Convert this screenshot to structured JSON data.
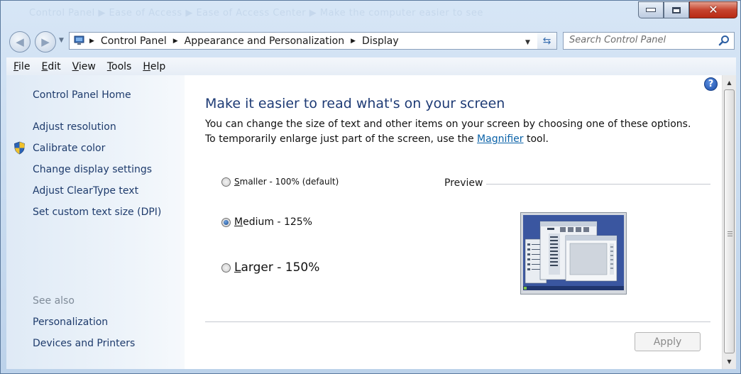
{
  "window": {
    "ghost_title": "Control Panel  ▶  Ease of Access  ▶  Ease of Access Center  ▶  Make the computer easier to see",
    "close_glyph": "✕"
  },
  "nav": {
    "back_glyph": "◀",
    "forward_glyph": "▶",
    "breadcrumb": [
      "Control Panel",
      "Appearance and Personalization",
      "Display"
    ],
    "breadcrumb_separator": "▶",
    "dropdown_glyph": "▼",
    "refresh_glyph": "⇆",
    "search_placeholder": "Search Control Panel"
  },
  "menu": [
    {
      "accel": "F",
      "rest": "ile"
    },
    {
      "accel": "E",
      "rest": "dit"
    },
    {
      "accel": "V",
      "rest": "iew"
    },
    {
      "accel": "T",
      "rest": "ools"
    },
    {
      "accel": "H",
      "rest": "elp"
    }
  ],
  "sidebar": {
    "home": "Control Panel Home",
    "links": [
      "Adjust resolution",
      "Calibrate color",
      "Change display settings",
      "Adjust ClearType text",
      "Set custom text size (DPI)"
    ],
    "see_also_heading": "See also",
    "see_also": [
      "Personalization",
      "Devices and Printers"
    ]
  },
  "main": {
    "help_glyph": "?",
    "heading": "Make it easier to read what's on your screen",
    "description_before": "You can change the size of text and other items on your screen by choosing one of these options. To temporarily enlarge just part of the screen, use the ",
    "description_link": "Magnifier",
    "description_after": " tool.",
    "options": [
      {
        "accel": "S",
        "rest": "maller - 100% (default)",
        "checked": false
      },
      {
        "accel": "M",
        "rest": "edium - 125%",
        "checked": true
      },
      {
        "accel": "L",
        "rest": "arger - 150%",
        "checked": false
      }
    ],
    "preview_label": "Preview",
    "apply_label": "Apply"
  },
  "colors": {
    "link": "#1e3b6c",
    "heading": "#1e3b75",
    "hyperlink": "#0a62a8",
    "close_button": "#c6442f"
  }
}
